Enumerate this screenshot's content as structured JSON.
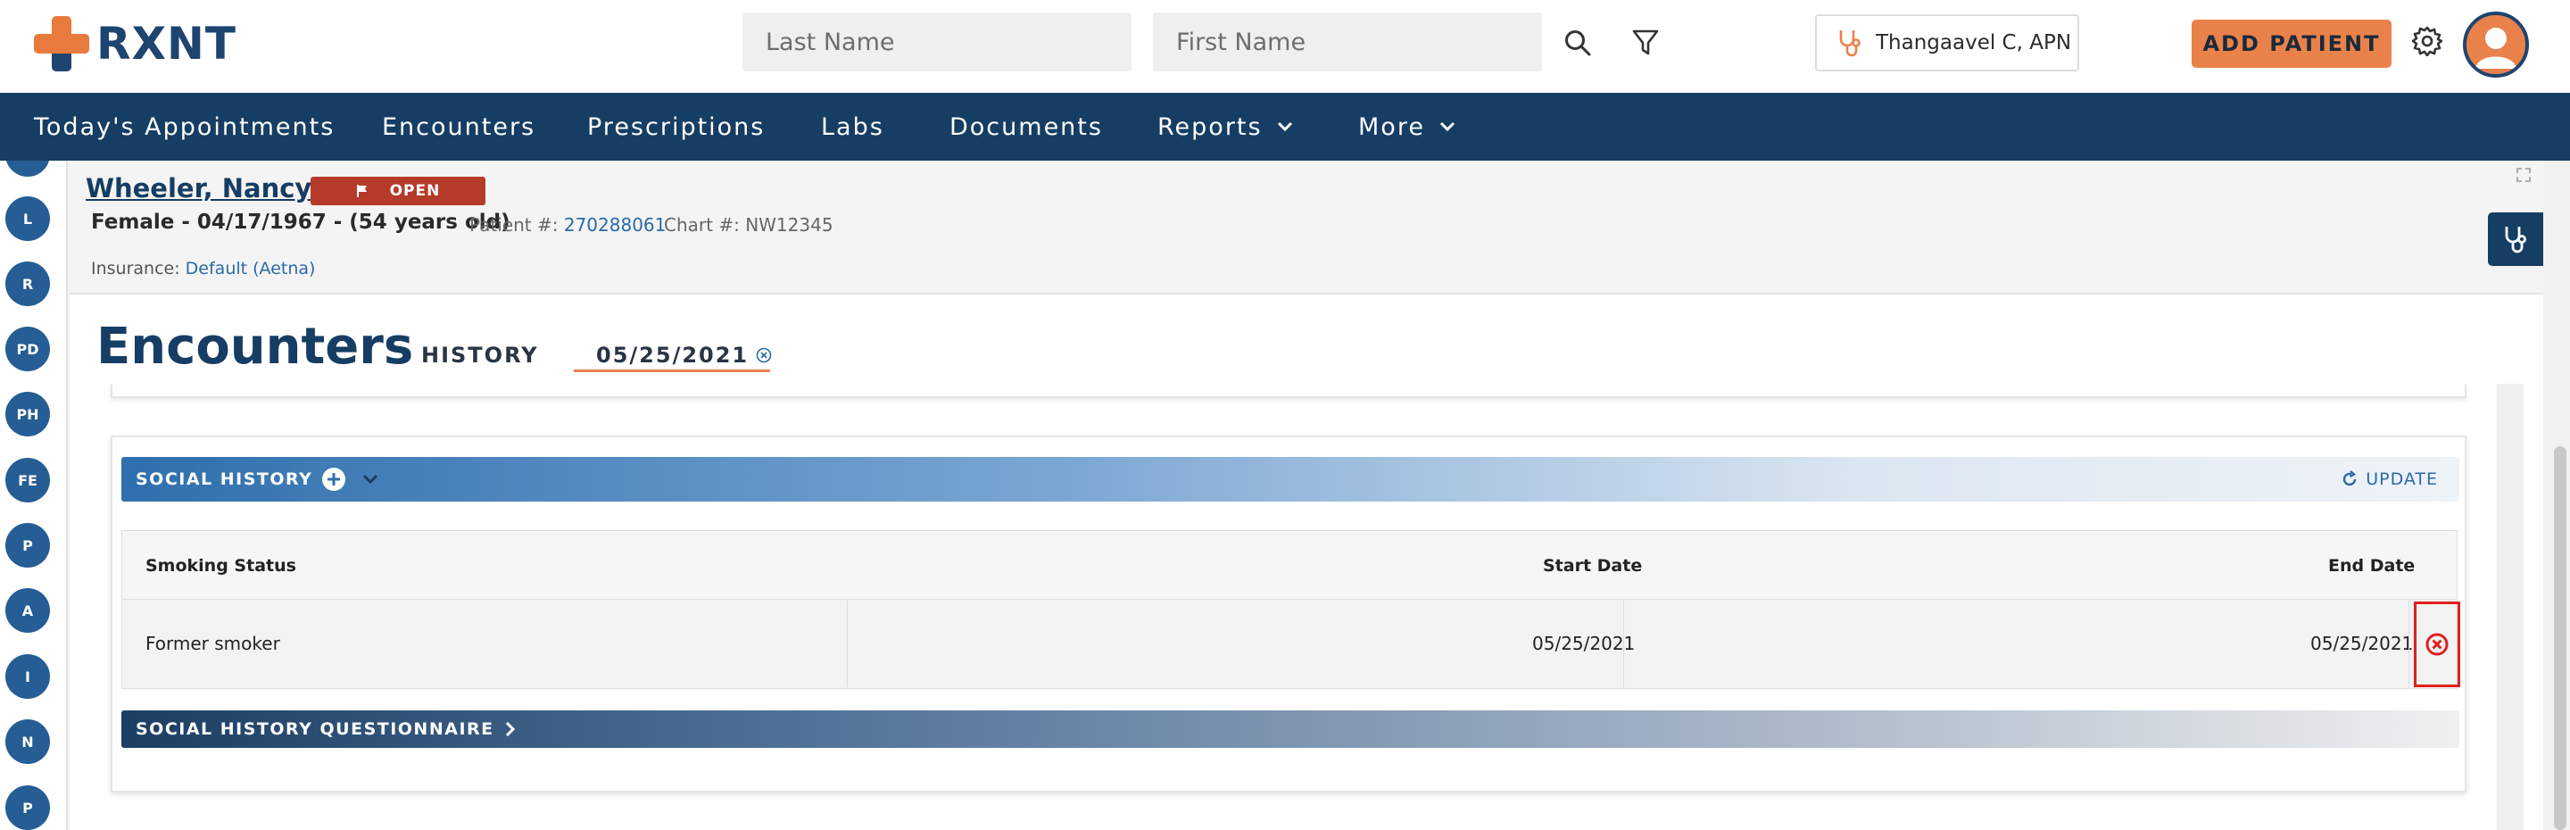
{
  "app": {
    "logo_text": "RXNT"
  },
  "search": {
    "last_name_placeholder": "Last Name",
    "first_name_placeholder": "First Name"
  },
  "header": {
    "provider": "Thangaavel C, APN",
    "add_patient_label": "ADD PATIENT"
  },
  "nav": {
    "items": [
      {
        "label": "Today's Appointments",
        "has_dropdown": false
      },
      {
        "label": "Encounters",
        "has_dropdown": false
      },
      {
        "label": "Prescriptions",
        "has_dropdown": false
      },
      {
        "label": "Labs",
        "has_dropdown": false
      },
      {
        "label": "Documents",
        "has_dropdown": false
      },
      {
        "label": "Reports",
        "has_dropdown": true
      },
      {
        "label": "More",
        "has_dropdown": true
      }
    ]
  },
  "rail": {
    "items": [
      "L",
      "R",
      "PD",
      "PH",
      "FE",
      "P",
      "A",
      "I",
      "N",
      "P"
    ]
  },
  "patient": {
    "name": "Wheeler, Nancy",
    "status": "OPEN",
    "demographics": "Female - 04/17/1967 - (54 years old)",
    "patient_number_label": "Patient #:",
    "patient_number": "270288061",
    "chart_number_label": "Chart #:",
    "chart_number": "NW12345",
    "insurance_label": "Insurance:",
    "insurance": "Default (Aetna)"
  },
  "encounters": {
    "title": "Encounters",
    "tabs": [
      {
        "label": "HISTORY",
        "active": false
      },
      {
        "label": "05/25/2021",
        "active": true
      }
    ]
  },
  "social_history": {
    "title": "SOCIAL HISTORY",
    "update_label": "UPDATE",
    "columns": [
      "Smoking Status",
      "Start Date",
      "End Date"
    ],
    "rows": [
      {
        "smoking_status": "Former smoker",
        "start_date": "05/25/2021",
        "end_date": "05/25/2021"
      }
    ]
  },
  "questionnaire": {
    "title": "SOCIAL HISTORY QUESTIONNAIRE"
  },
  "colors": {
    "brand_navy": "#163d63",
    "brand_orange": "#e9824a",
    "status_red": "#b63a2a",
    "link_blue": "#2a6aa6",
    "highlight_red": "#e0201e"
  }
}
